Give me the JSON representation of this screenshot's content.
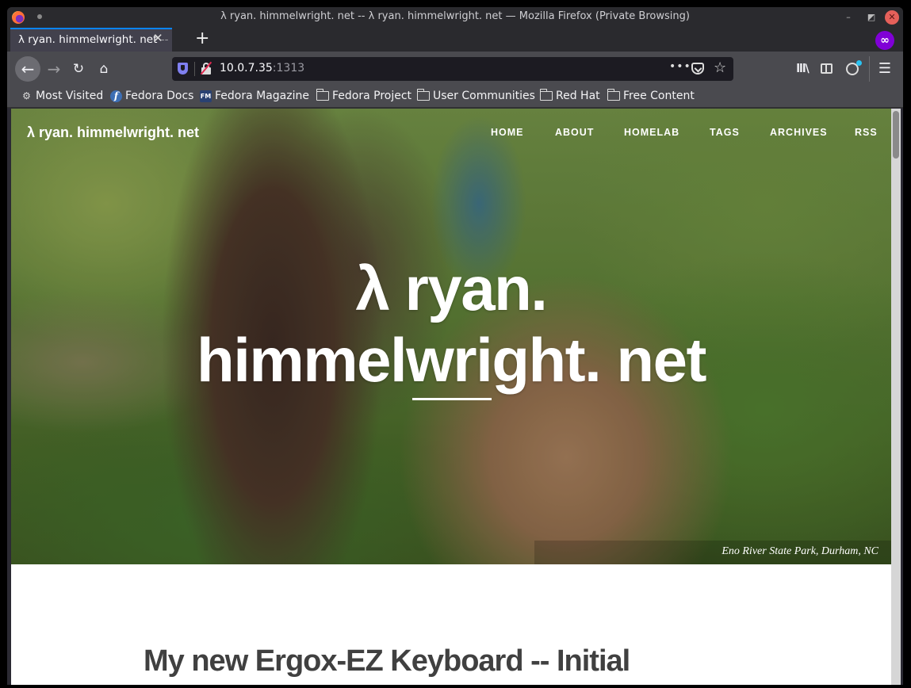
{
  "window": {
    "title": "λ ryan. himmelwright. net -- λ ryan. himmelwright. net — Mozilla Firefox (Private Browsing)",
    "controls": {
      "minimize": "–",
      "maximize": "◩",
      "close": "✕"
    }
  },
  "tabs": [
    {
      "label": "λ ryan. himmelwright. net",
      "label_fade": " -- ",
      "close": "✕",
      "active": true
    }
  ],
  "new_tab_label": "+",
  "private_icon": "∞",
  "toolbar": {
    "back": "←",
    "forward": "→",
    "reload": "↻",
    "home": "⌂",
    "url_host": "10.0.7.35",
    "url_port": ":1313",
    "page_actions": "•••",
    "bookmark_star": "☆",
    "library": "lll\\",
    "menu": "☰"
  },
  "bookmarks": [
    {
      "label": "Most Visited",
      "icon": "gear-icon",
      "glyph": "⚙"
    },
    {
      "label": "Fedora Docs",
      "icon": "fedora-icon",
      "glyph": "f"
    },
    {
      "label": "Fedora Magazine",
      "icon": "fedora-magazine-icon",
      "glyph": "FM"
    },
    {
      "label": "Fedora Project",
      "icon": "folder-icon",
      "glyph": ""
    },
    {
      "label": "User Communities",
      "icon": "folder-icon",
      "glyph": ""
    },
    {
      "label": "Red Hat",
      "icon": "folder-icon",
      "glyph": ""
    },
    {
      "label": "Free Content",
      "icon": "folder-icon",
      "glyph": ""
    }
  ],
  "site": {
    "brand": "λ ryan. himmelwright. net",
    "nav": [
      "HOME",
      "ABOUT",
      "HOMELAB",
      "TAGS",
      "ARCHIVES",
      "RSS"
    ],
    "hero_title_line1": "λ ryan.",
    "hero_title_line2": "himmelwright. net",
    "hero_caption": "Eno River State Park, Durham, NC",
    "post_title": "My new Ergox-EZ Keyboard -- Initial"
  },
  "colors": {
    "private_purple": "#8000d7",
    "tab_accent": "#0a84ff",
    "close_red": "#e5605a",
    "account_badge": "#2ac3f3"
  }
}
